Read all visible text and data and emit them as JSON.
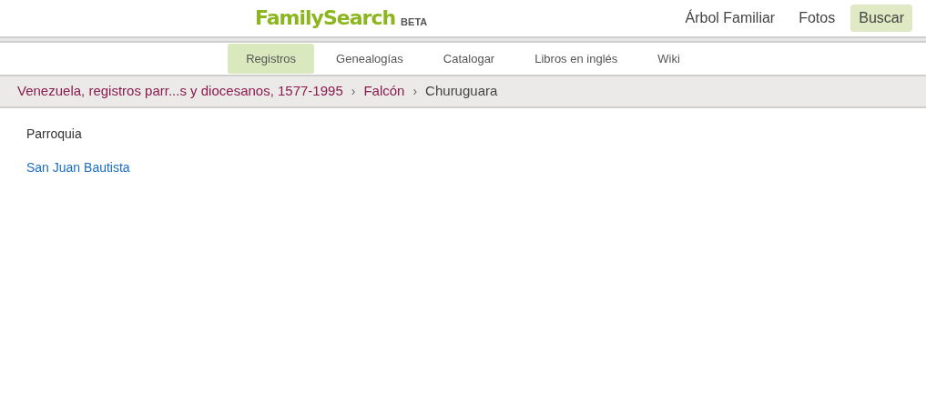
{
  "header": {
    "logo": "FamilySearch",
    "logo_badge": "BETA",
    "nav": [
      {
        "label": "Árbol Familiar",
        "selected": false
      },
      {
        "label": "Fotos",
        "selected": false
      },
      {
        "label": "Buscar",
        "selected": true
      }
    ]
  },
  "subnav": [
    {
      "label": "Registros",
      "selected": true
    },
    {
      "label": "Genealogías",
      "selected": false
    },
    {
      "label": "Catalogar",
      "selected": false
    },
    {
      "label": "Libros en inglés",
      "selected": false
    },
    {
      "label": "Wiki",
      "selected": false
    }
  ],
  "breadcrumb": {
    "items": [
      {
        "label": "Venezuela, registros parr...s y diocesanos, 1577-1995",
        "current": false
      },
      {
        "label": "Falcón",
        "current": false
      },
      {
        "label": "Churuguara",
        "current": true
      }
    ],
    "separators": [
      "›",
      "›"
    ]
  },
  "content": {
    "heading": "Parroquia",
    "links": [
      "San Juan Bautista"
    ]
  }
}
